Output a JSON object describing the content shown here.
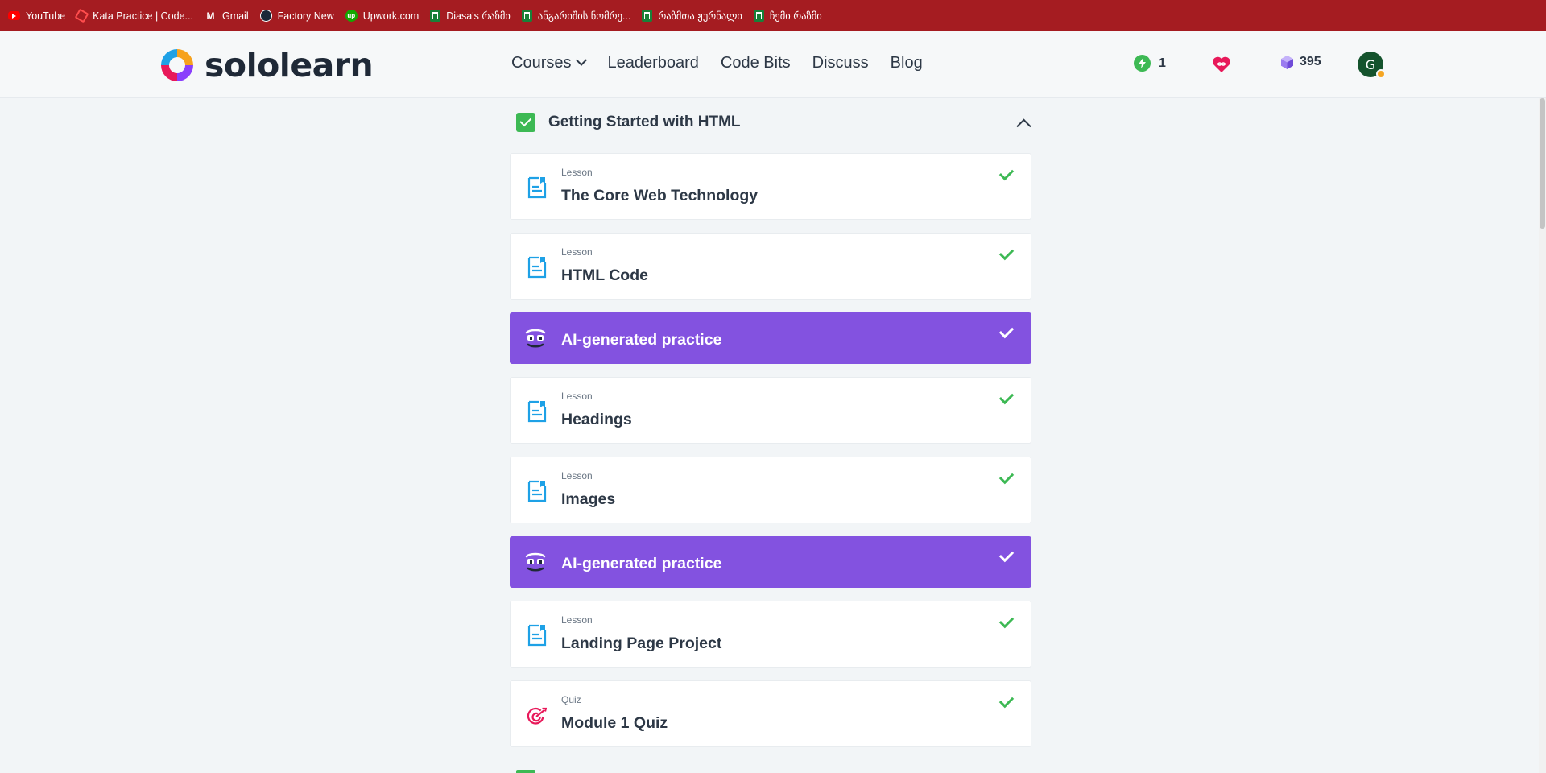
{
  "bookmarks": [
    {
      "label": "YouTube",
      "icon": "youtube-icon"
    },
    {
      "label": "Kata Practice | Code...",
      "icon": "codewars-icon"
    },
    {
      "label": "Gmail",
      "icon": "gmail-icon"
    },
    {
      "label": "Factory New",
      "icon": "steam-icon"
    },
    {
      "label": "Upwork.com",
      "icon": "upwork-icon"
    },
    {
      "label": "Diasa's რაზმი",
      "icon": "sheets-icon"
    },
    {
      "label": "ანგარიშის ნომრე...",
      "icon": "sheets-icon"
    },
    {
      "label": "რაზმთა ჟურნალი",
      "icon": "sheets-icon"
    },
    {
      "label": "ჩემი რაზმი",
      "icon": "sheets-icon"
    }
  ],
  "header": {
    "logo_text": "sololearn",
    "nav": [
      "Courses",
      "Leaderboard",
      "Code Bits",
      "Discuss",
      "Blog"
    ],
    "streak": "1",
    "gems": "395",
    "avatar_letter": "G"
  },
  "module": {
    "title": "Getting Started with HTML",
    "items": [
      {
        "kind": "lesson",
        "type": "Lesson",
        "name": "The Core Web Technology",
        "completed": true
      },
      {
        "kind": "lesson",
        "type": "Lesson",
        "name": "HTML Code",
        "completed": true
      },
      {
        "kind": "ai",
        "type": "",
        "name": "AI-generated practice",
        "completed": true
      },
      {
        "kind": "lesson",
        "type": "Lesson",
        "name": "Headings",
        "completed": true
      },
      {
        "kind": "lesson",
        "type": "Lesson",
        "name": "Images",
        "completed": true
      },
      {
        "kind": "ai",
        "type": "",
        "name": "AI-generated practice",
        "completed": true
      },
      {
        "kind": "lesson",
        "type": "Lesson",
        "name": "Landing Page Project",
        "completed": true
      },
      {
        "kind": "quiz",
        "type": "Quiz",
        "name": "Module 1 Quiz",
        "completed": true
      }
    ]
  },
  "colors": {
    "bookmark_bar": "#a51c21",
    "ai_card": "#8352e0",
    "complete_green": "#3db954",
    "lesson_icon": "#1ea1e6",
    "quiz_icon": "#e8195a"
  }
}
